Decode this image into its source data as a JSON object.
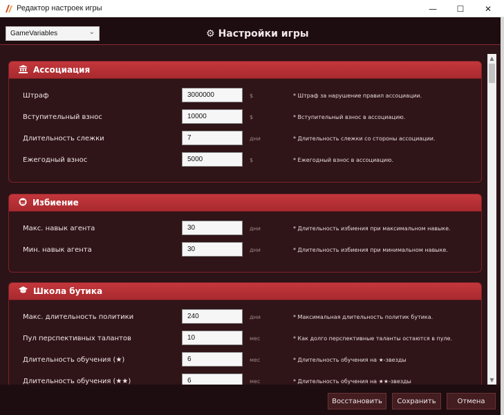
{
  "window": {
    "title": "Редактор настроек игры",
    "min_glyph": "—",
    "max_glyph": "☐",
    "close_glyph": "✕"
  },
  "header": {
    "select_value": "GameVariables",
    "title": "Настройки игры"
  },
  "icons": {
    "app": "app-icon",
    "header": "gear-icon"
  },
  "sections": [
    {
      "title": "Ассоциация",
      "icon": "bank-icon",
      "rows": [
        {
          "label": "Штраф",
          "value": "3000000",
          "unit": "$",
          "desc": "* Штраф за нарушение правил ассоциации."
        },
        {
          "label": "Вступительный взнос",
          "value": "10000",
          "unit": "$",
          "desc": "* Вступительный взнос в ассоциацию."
        },
        {
          "label": "Длительность слежки",
          "value": "7",
          "unit": "дни",
          "desc": "* Длительность слежки со стороны ассоциации."
        },
        {
          "label": "Ежегодный взнос",
          "value": "5000",
          "unit": "$",
          "desc": "* Ежегодный взнос в ассоциацию."
        }
      ]
    },
    {
      "title": "Избиение",
      "icon": "fist-icon",
      "rows": [
        {
          "label": "Макс. навык агента",
          "value": "30",
          "unit": "дни",
          "desc": "* Длительность избиения при максимальном навыке."
        },
        {
          "label": "Мин. навык агента",
          "value": "30",
          "unit": "дни",
          "desc": "* Длительность избиения при минимальном навыке."
        }
      ]
    },
    {
      "title": "Школа бутика",
      "icon": "graduation-cap-icon",
      "rows": [
        {
          "label": "Макс. длительность политики",
          "value": "240",
          "unit": "дни",
          "desc": "* Максимальная длительность политик бутика."
        },
        {
          "label": "Пул перспективных талантов",
          "value": "10",
          "unit": "мес",
          "desc": "* Как долго перспективные таланты остаются в пуле."
        },
        {
          "label": "Длительность обучения (★)",
          "value": "6",
          "unit": "мес",
          "desc": "* Длительность обучения на ★-звезды"
        },
        {
          "label": "Длительность обучения (★★)",
          "value": "6",
          "unit": "мес",
          "desc": "* Длительность обучения на ★★-звезды"
        }
      ]
    }
  ],
  "footer": {
    "restore": "Восстановить",
    "save": "Сохранить",
    "cancel": "Отмена"
  }
}
